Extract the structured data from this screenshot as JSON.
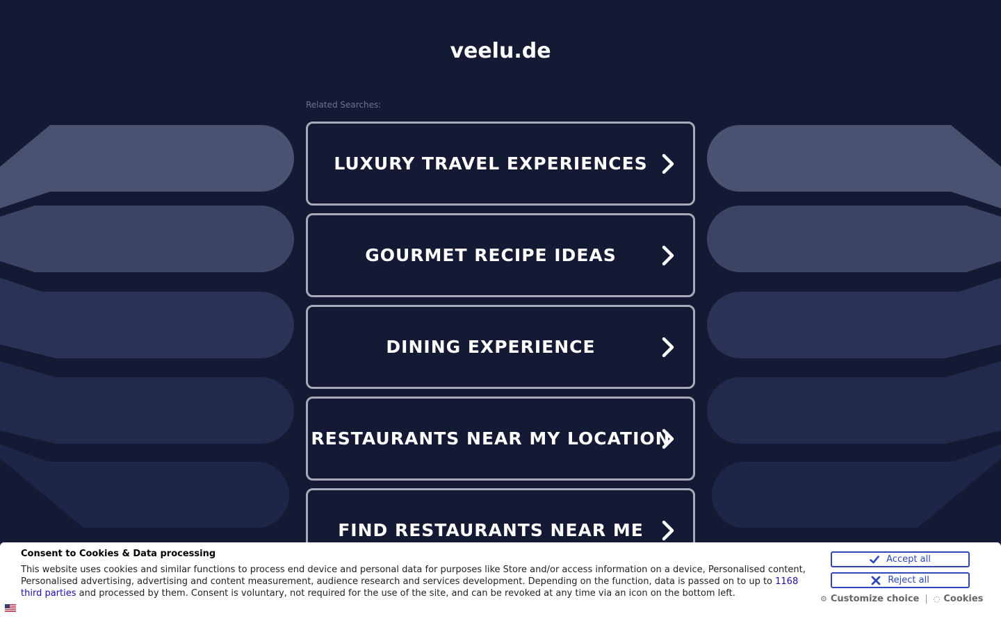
{
  "site": {
    "title": "veelu.de",
    "related_label": "Related Searches:"
  },
  "searches": [
    {
      "label": "LUXURY TRAVEL EXPERIENCES",
      "icon": "chevron-right-icon"
    },
    {
      "label": "GOURMET RECIPE IDEAS",
      "icon": "chevron-right-icon"
    },
    {
      "label": "DINING EXPERIENCE",
      "icon": "chevron-right-icon"
    },
    {
      "label": "RESTAURANTS NEAR MY LOCATION",
      "icon": "chevron-right-icon"
    },
    {
      "label": "FIND RESTAURANTS NEAR ME",
      "icon": "chevron-right-icon"
    }
  ],
  "consent": {
    "title": "Consent to Cookies & Data processing",
    "text_before_link": "This website uses cookies and similar functions to process end device and personal data for purposes like Store and/or access information on a device, Personalised content, Personalised advertising, advertising and content measurement, audience research and services development. Depending on the function, data is passed on to up to ",
    "link_text": "1168 third parties",
    "text_after_link": " and processed by them. Consent is voluntary, not required for the use of the site, and can be revoked at any time via an icon on the bottom left.",
    "accept_label": "Accept all",
    "reject_label": "Reject all",
    "customize_label": "Customize choice",
    "separator": "|",
    "cookies_label": "Cookies",
    "language_icon": "uk-flag-icon"
  },
  "colors": {
    "background": "#141a33",
    "card_border": "#a8abb5",
    "button_accent": "#2f47b8",
    "link": "#1a0dab"
  }
}
